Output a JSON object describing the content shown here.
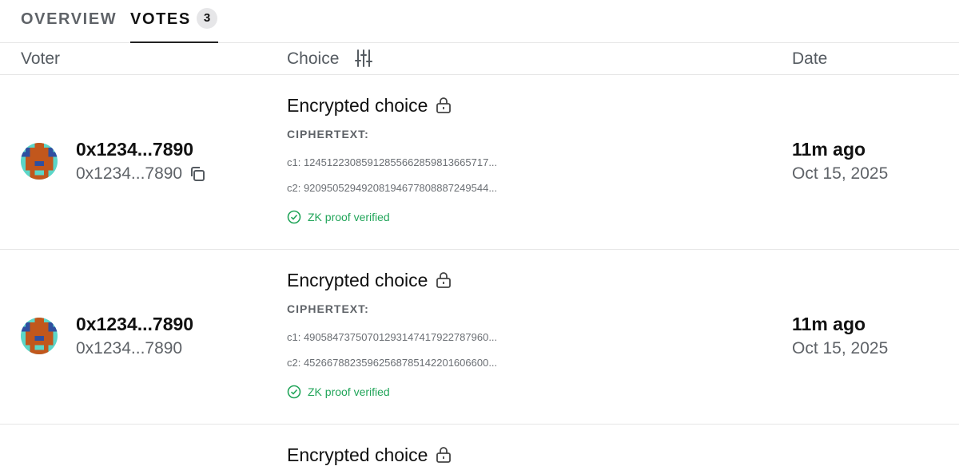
{
  "tabs": {
    "overview": "OVERVIEW",
    "votes": "VOTES",
    "votes_count": "3"
  },
  "columns": {
    "voter": "Voter",
    "choice": "Choice",
    "date": "Date"
  },
  "icons": {
    "filter": "sliders-icon",
    "copy": "copy-icon",
    "lock": "lock-icon",
    "verified": "check-circle-icon"
  },
  "colors": {
    "verified": "#22a55a",
    "muted": "#5f6368",
    "avatar_teal": "#5bd6c8",
    "avatar_blue": "#2f4fa0",
    "avatar_orange": "#c2571c"
  },
  "votes": [
    {
      "voter_name": "0x1234...7890",
      "voter_address": "0x1234...7890",
      "choice_title": "Encrypted choice",
      "ciphertext_label": "CIPHERTEXT:",
      "c1": "c1: 12451223085912855662859813665717...",
      "c2": "c2: 92095052949208194677808887249544...",
      "proof_status": "ZK proof verified",
      "time_ago": "11m ago",
      "date": "Oct 15, 2025"
    },
    {
      "voter_name": "0x1234...7890",
      "voter_address": "0x1234...7890",
      "choice_title": "Encrypted choice",
      "ciphertext_label": "CIPHERTEXT:",
      "c1": "c1: 49058473750701293147417922787960...",
      "c2": "c2: 45266788235962568785142201606600...",
      "proof_status": "ZK proof verified",
      "time_ago": "11m ago",
      "date": "Oct 15, 2025"
    },
    {
      "choice_title": "Encrypted choice"
    }
  ]
}
